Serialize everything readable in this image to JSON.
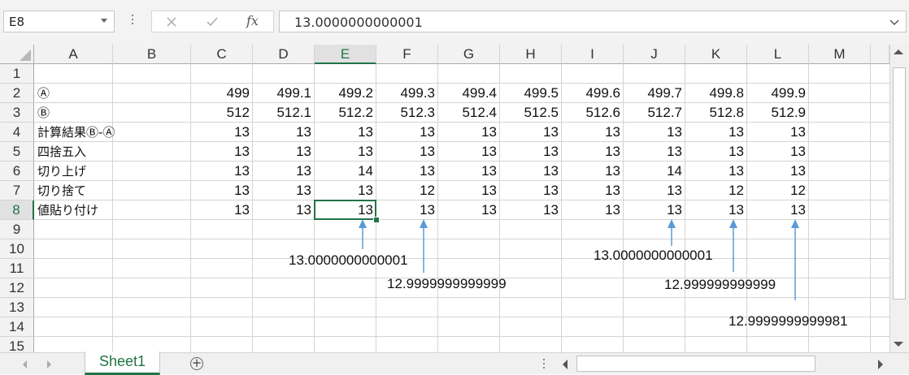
{
  "name_box": "E8",
  "formula_bar": {
    "value": "13.0000000000001",
    "cancel_icon": "close-icon",
    "enter_icon": "check-icon",
    "fx_label": "fx"
  },
  "columns": [
    "A",
    "B",
    "C",
    "D",
    "E",
    "F",
    "G",
    "H",
    "I",
    "J",
    "K",
    "L",
    "M"
  ],
  "selected_column": "E",
  "rows": [
    "1",
    "2",
    "3",
    "4",
    "5",
    "6",
    "7",
    "8",
    "9",
    "10",
    "11",
    "12",
    "13",
    "14",
    "15"
  ],
  "selected_row": "8",
  "table": [
    {
      "row": "2",
      "label": "Ⓐ",
      "values": [
        "499",
        "499.1",
        "499.2",
        "499.3",
        "499.4",
        "499.5",
        "499.6",
        "499.7",
        "499.8",
        "499.9"
      ]
    },
    {
      "row": "3",
      "label": "Ⓑ",
      "values": [
        "512",
        "512.1",
        "512.2",
        "512.3",
        "512.4",
        "512.5",
        "512.6",
        "512.7",
        "512.8",
        "512.9"
      ]
    },
    {
      "row": "4",
      "label": "計算結果Ⓑ-Ⓐ",
      "values": [
        "13",
        "13",
        "13",
        "13",
        "13",
        "13",
        "13",
        "13",
        "13",
        "13"
      ]
    },
    {
      "row": "5",
      "label": "四捨五入",
      "values": [
        "13",
        "13",
        "13",
        "13",
        "13",
        "13",
        "13",
        "13",
        "13",
        "13"
      ]
    },
    {
      "row": "6",
      "label": "切り上げ",
      "values": [
        "13",
        "13",
        "14",
        "13",
        "13",
        "13",
        "13",
        "14",
        "13",
        "13"
      ]
    },
    {
      "row": "7",
      "label": "切り捨て",
      "values": [
        "13",
        "13",
        "13",
        "12",
        "13",
        "13",
        "13",
        "13",
        "12",
        "12"
      ]
    },
    {
      "row": "8",
      "label": "値貼り付け",
      "values": [
        "13",
        "13",
        "13",
        "13",
        "13",
        "13",
        "13",
        "13",
        "13",
        "13"
      ]
    }
  ],
  "annotations": [
    {
      "column": "E",
      "text": "13.0000000000001"
    },
    {
      "column": "F",
      "text": "12.9999999999999"
    },
    {
      "column": "J",
      "text": "13.0000000000001"
    },
    {
      "column": "K",
      "text": "12.999999999999"
    },
    {
      "column": "L",
      "text": "12.9999999999981"
    }
  ],
  "arrow_color": "#5b9bd5",
  "accent_color": "#217346",
  "sheet_tabs": [
    "Sheet1"
  ],
  "active_sheet": "Sheet1",
  "add_sheet_icon": "plus-circle-icon"
}
